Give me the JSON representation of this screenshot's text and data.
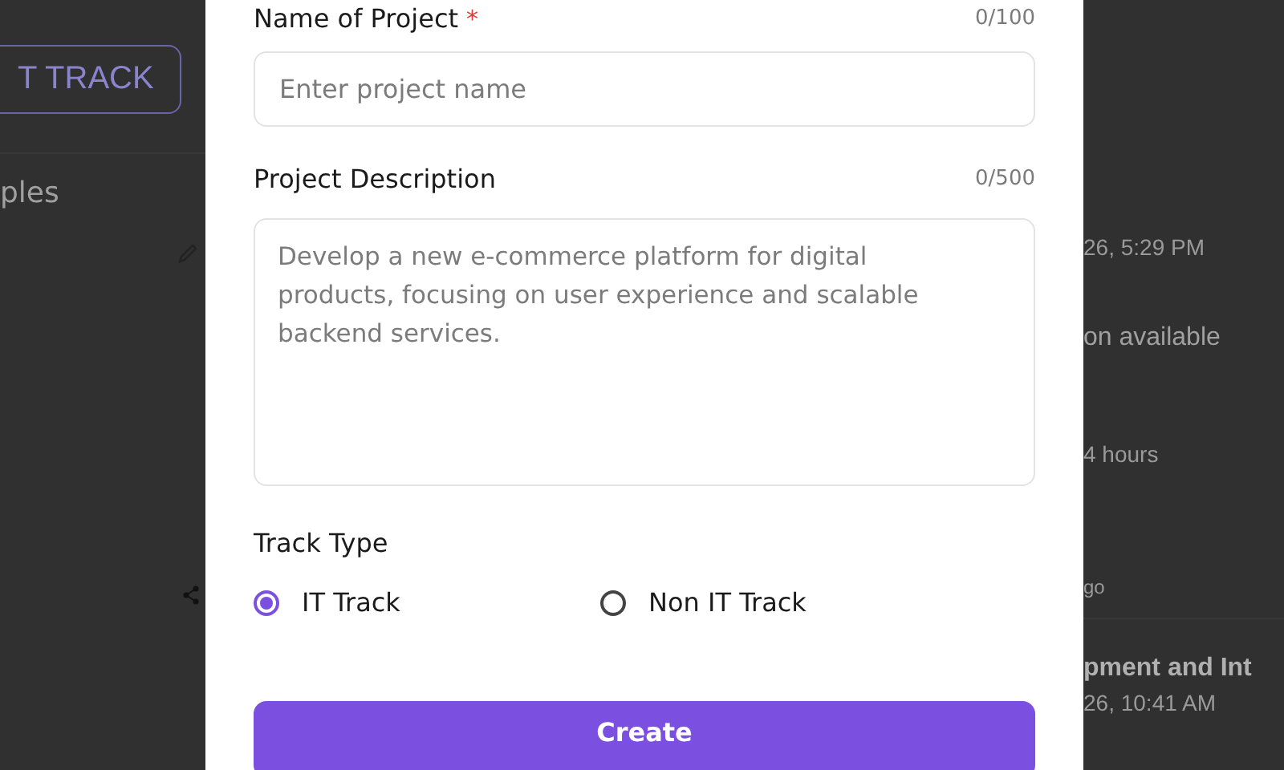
{
  "background": {
    "left": {
      "button": "T TRACK",
      "heading": "ples"
    },
    "right": [
      {
        "kind": "meta",
        "text": "26, 5:29 PM"
      },
      {
        "kind": "body",
        "text": "on available"
      },
      {
        "kind": "meta",
        "text": "4 hours"
      },
      {
        "kind": "small",
        "text": "go"
      },
      {
        "kind": "title",
        "text": "pment and Int"
      },
      {
        "kind": "meta",
        "text": "26, 10:41 AM"
      }
    ]
  },
  "modal": {
    "name_field": {
      "label": "Name of Project",
      "required_mark": "*",
      "counter": "0/100",
      "placeholder": "Enter project name"
    },
    "description_field": {
      "label": "Project Description",
      "counter": "0/500",
      "placeholder": "Develop a new e-commerce platform for digital products, focusing on user experience and scalable backend services."
    },
    "track_type": {
      "label": "Track Type",
      "options": [
        {
          "label": "IT Track",
          "selected": true
        },
        {
          "label": "Non IT Track",
          "selected": false
        }
      ]
    },
    "submit": "Create"
  }
}
